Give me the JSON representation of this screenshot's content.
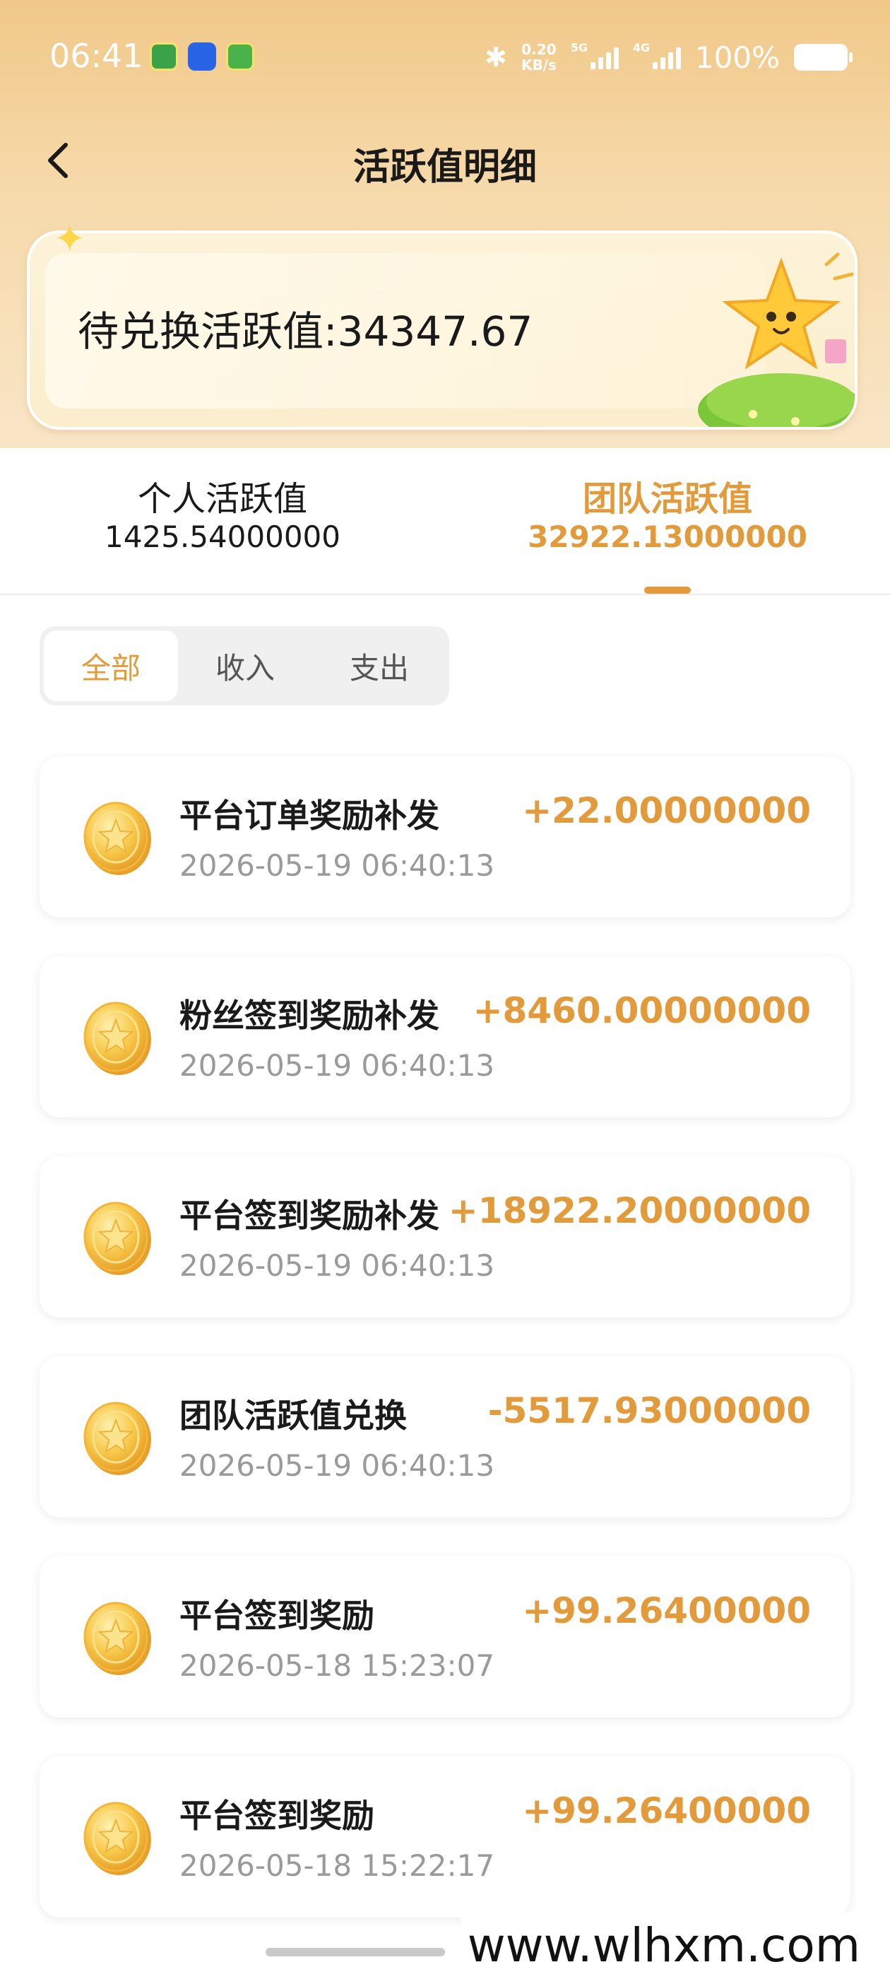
{
  "status_bar": {
    "time": "06:41",
    "net_speed_value": "0.20",
    "net_speed_unit": "KB/s",
    "sim1_label": "5G",
    "sim2_label": "4G",
    "battery_percent": "100%",
    "icons": [
      "bluetooth-icon",
      "signal-icon",
      "battery-icon"
    ]
  },
  "nav": {
    "title": "活跃值明细",
    "back_icon": "chevron-left-icon"
  },
  "banner": {
    "label": "待兑换活跃值:34347.67"
  },
  "tabs": [
    {
      "title": "个人活跃值",
      "value": "1425.54000000",
      "active": false
    },
    {
      "title": "团队活跃值",
      "value": "32922.13000000",
      "active": true
    }
  ],
  "filters": [
    {
      "label": "全部",
      "active": true
    },
    {
      "label": "收入",
      "active": false
    },
    {
      "label": "支出",
      "active": false
    }
  ],
  "records": [
    {
      "title": "平台订单奖励补发",
      "time": "2026-05-19 06:40:13",
      "amount": "+22.00000000"
    },
    {
      "title": "粉丝签到奖励补发",
      "time": "2026-05-19 06:40:13",
      "amount": "+8460.00000000"
    },
    {
      "title": "平台签到奖励补发",
      "time": "2026-05-19 06:40:13",
      "amount": "+18922.20000000"
    },
    {
      "title": "团队活跃值兑换",
      "time": "2026-05-19 06:40:13",
      "amount": "-5517.93000000"
    },
    {
      "title": "平台签到奖励",
      "time": "2026-05-18 15:23:07",
      "amount": "+99.26400000"
    },
    {
      "title": "平台签到奖励",
      "time": "2026-05-18 15:22:17",
      "amount": "+99.26400000"
    }
  ],
  "watermark": "www.wlhxm.com",
  "colors": {
    "accent": "#e29a3b",
    "header_bg": "#f1c888"
  }
}
